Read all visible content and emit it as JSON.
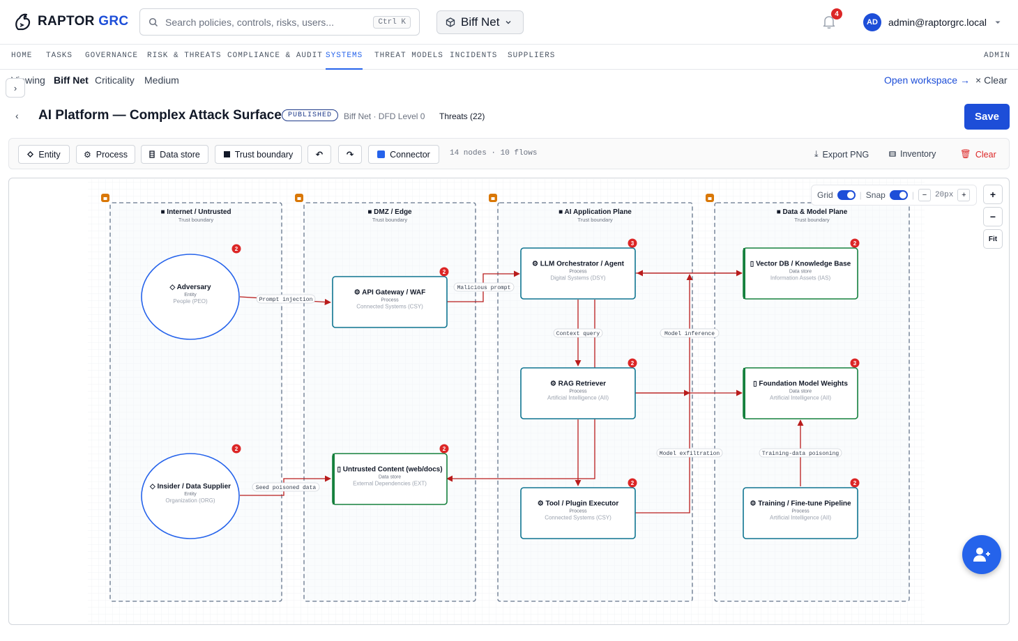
{
  "app": {
    "brand_left": "RAPTOR",
    "brand_right": "GRC",
    "search_placeholder": "Search policies, controls, risks, users...",
    "search_shortcut": "Ctrl K",
    "system_selector": "Biff Net",
    "notifications_count": "4",
    "user_initials": "AD",
    "user_email": "admin@raptorgrc.local"
  },
  "nav": {
    "items": [
      {
        "label": "HOME",
        "active": false
      },
      {
        "label": "TASKS",
        "active": false
      },
      {
        "label": "GOVERNANCE",
        "active": false
      },
      {
        "label": "RISK & THREATS",
        "active": false
      },
      {
        "label": "COMPLIANCE & AUDIT",
        "active": false
      },
      {
        "label": "SYSTEMS",
        "active": true
      },
      {
        "label": "THREAT MODELS",
        "active": false
      },
      {
        "label": "INCIDENTS",
        "active": false
      },
      {
        "label": "SUPPLIERS",
        "active": false
      }
    ],
    "admin": "ADMIN"
  },
  "context": {
    "viewing_label": "Viewing",
    "system_name": "Biff Net",
    "criticality_label": "Criticality",
    "criticality": "Medium",
    "open_workspace": "Open workspace →",
    "clear": "Clear"
  },
  "header": {
    "title": "AI Platform — Complex Attack Surface",
    "status": "PUBLISHED",
    "subtitle": "Biff Net · DFD Level 0",
    "threats": "Threats (22)",
    "save": "Save"
  },
  "toolbar": {
    "entity": "Entity",
    "process": "Process",
    "data_store": "Data store",
    "trust_boundary": "Trust boundary",
    "undo": "↶",
    "redo": "↷",
    "connector": "Connector",
    "stats": "14 nodes · 10 flows",
    "export_png": "Export PNG",
    "inventory": "Inventory",
    "clear": "Clear"
  },
  "canvas_controls": {
    "grid": "Grid",
    "snap": "Snap",
    "grid_size": "20px",
    "zoom_in": "+",
    "zoom_out": "−",
    "fit": "Fit"
  },
  "colors": {
    "accent": "#1d4ed8",
    "entity_border": "#2563eb",
    "process_border": "#0e7490",
    "store_border": "#15803d",
    "flow": "#b91c1c",
    "badge": "#dc2626",
    "boundary": "#64748b"
  },
  "boundaries": [
    {
      "name": "Internet / Untrusted",
      "kind": "Trust boundary"
    },
    {
      "name": "DMZ / Edge",
      "kind": "Trust boundary"
    },
    {
      "name": "AI Application Plane",
      "kind": "Trust boundary"
    },
    {
      "name": "Data & Model Plane",
      "kind": "Trust boundary"
    }
  ],
  "nodes": [
    {
      "id": "adversary",
      "type": "entity",
      "icon": "◇",
      "label": "Adversary",
      "kind": "Entity",
      "category": "People (PEO)",
      "threats": 2
    },
    {
      "id": "insider",
      "type": "entity",
      "icon": "◇",
      "label": "Insider / Data Supplier",
      "kind": "Entity",
      "category": "Organization (ORG)",
      "threats": 2
    },
    {
      "id": "gateway",
      "type": "process",
      "icon": "⚙",
      "label": "API Gateway / WAF",
      "kind": "Process",
      "category": "Connected Systems (CSY)",
      "threats": 2
    },
    {
      "id": "untrusted",
      "type": "store",
      "icon": "▯",
      "label": "Untrusted Content (web/docs)",
      "kind": "Data store",
      "category": "External Dependencies (EXT)",
      "threats": 2
    },
    {
      "id": "llm",
      "type": "process",
      "icon": "⚙",
      "label": "LLM Orchestrator / Agent",
      "kind": "Process",
      "category": "Digital Systems (DSY)",
      "threats": 3
    },
    {
      "id": "rag",
      "type": "process",
      "icon": "⚙",
      "label": "RAG Retriever",
      "kind": "Process",
      "category": "Artificial Intelligence (AII)",
      "threats": 2
    },
    {
      "id": "tool",
      "type": "process",
      "icon": "⚙",
      "label": "Tool / Plugin Executor",
      "kind": "Process",
      "category": "Connected Systems (CSY)",
      "threats": 2
    },
    {
      "id": "vector",
      "type": "store",
      "icon": "▯",
      "label": "Vector DB / Knowledge Base",
      "kind": "Data store",
      "category": "Information Assets (IAS)",
      "threats": 2
    },
    {
      "id": "weights",
      "type": "store",
      "icon": "▯",
      "label": "Foundation Model Weights",
      "kind": "Data store",
      "category": "Artificial Intelligence (AII)",
      "threats": 3
    },
    {
      "id": "training",
      "type": "process",
      "icon": "⚙",
      "label": "Training / Fine-tune Pipeline",
      "kind": "Process",
      "category": "Artificial Intelligence (AII)",
      "threats": 2
    }
  ],
  "flow_labels": [
    "Prompt injection",
    "Malicious prompt",
    "Seed poisoned data",
    "Context query",
    "Model inference",
    "Model exfiltration",
    "Training-data poisoning"
  ]
}
